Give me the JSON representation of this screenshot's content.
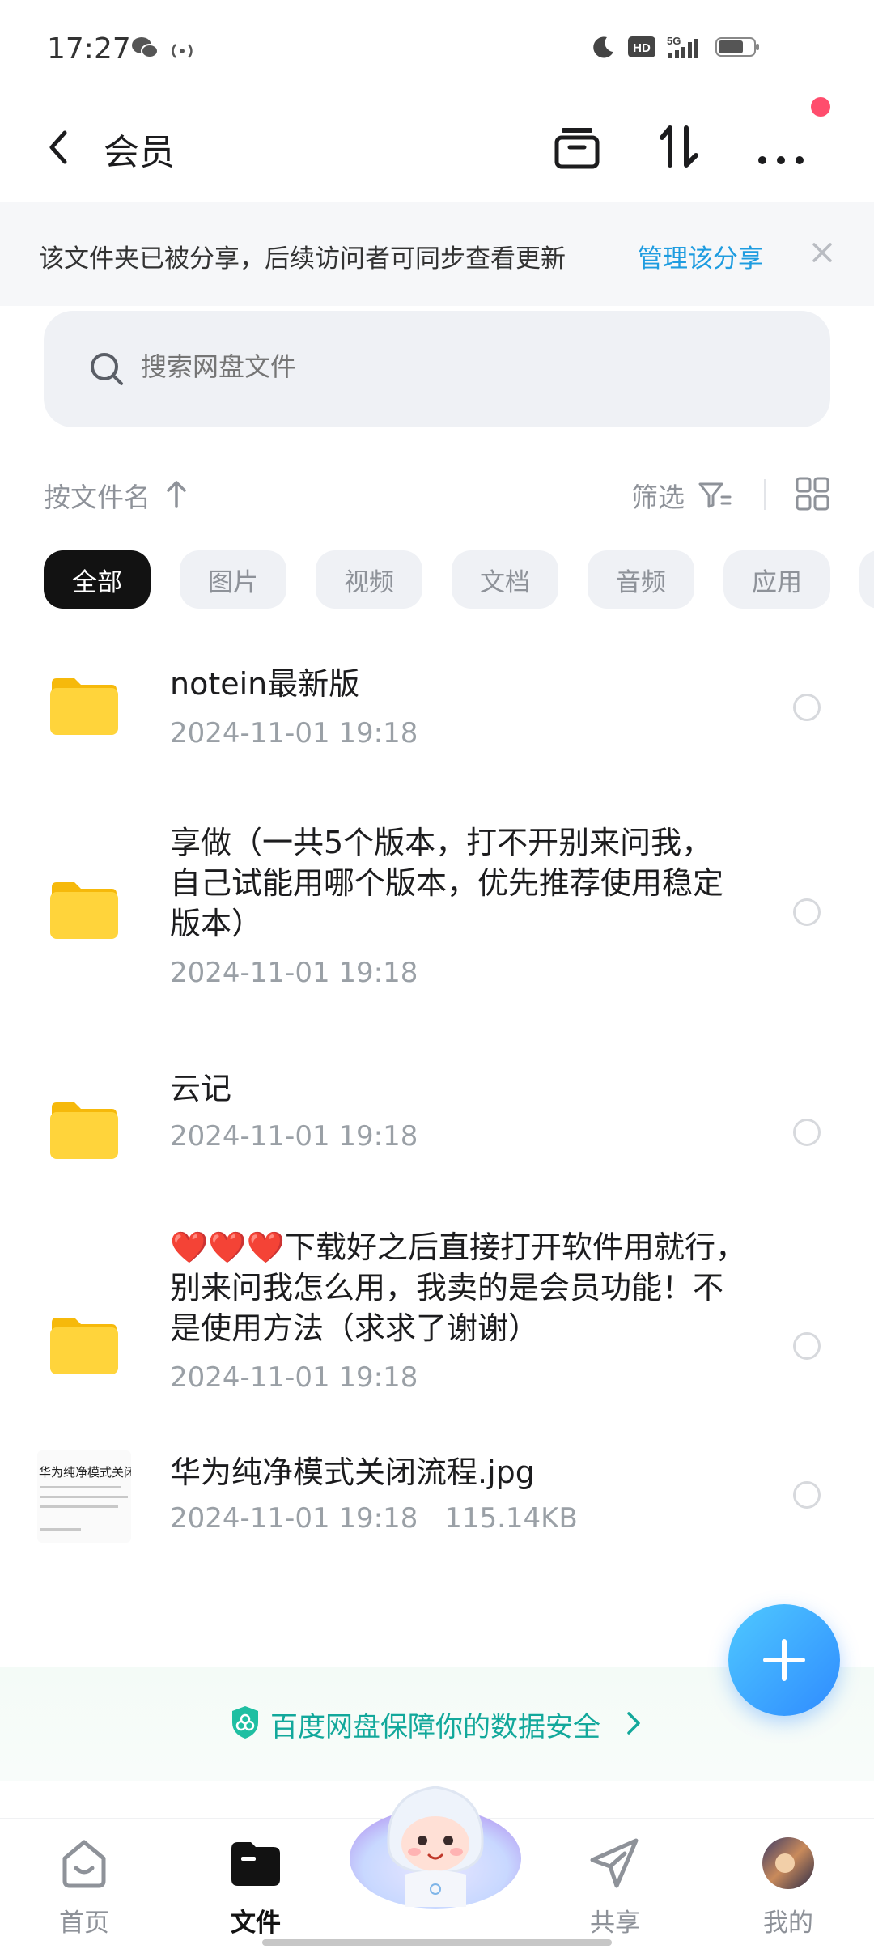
{
  "status_bar": {
    "time": "17:27",
    "hd_label": "HD",
    "network_label": "5G"
  },
  "header": {
    "title": "会员"
  },
  "share_banner": {
    "text": "该文件夹已被分享，后续访问者可同步查看更新",
    "action": "管理该分享"
  },
  "search": {
    "placeholder": "搜索网盘文件"
  },
  "sort": {
    "label": "按文件名",
    "filter_label": "筛选"
  },
  "categories": [
    "全部",
    "图片",
    "视频",
    "文档",
    "音频",
    "应用"
  ],
  "files": [
    {
      "name": "notein最新版",
      "date": "2024-11-01  19:18",
      "type": "folder"
    },
    {
      "name": "享做（一共5个版本，打不开别来问我，自己试能用哪个版本，优先推荐使用稳定版本）",
      "date": "2024-11-01  19:18",
      "type": "folder"
    },
    {
      "name": "云记",
      "date": "2024-11-01  19:18",
      "type": "folder"
    },
    {
      "name": "❤️❤️❤️下载好之后直接打开软件用就行，别来问我怎么用，我卖的是会员功能！不是使用方法（求求了谢谢）",
      "date": "2024-11-01  19:18",
      "type": "folder"
    },
    {
      "name": "华为纯净模式关闭流程.jpg",
      "date": "2024-11-01  19:18",
      "size": "115.14KB",
      "type": "image",
      "thumb_title": "华为纯净模式关闭流程"
    }
  ],
  "security_banner": {
    "text": "百度网盘保障你的数据安全"
  },
  "bottom_nav": [
    {
      "label": "首页",
      "active": false
    },
    {
      "label": "文件",
      "active": true
    },
    {
      "label": "共享",
      "active": false
    },
    {
      "label": "我的",
      "active": false
    }
  ],
  "colors": {
    "accent": "#1e9ce0",
    "security": "#12a89b",
    "notify_dot": "#ff4d6d",
    "folder": "#ffd43b",
    "fab": "#2f8bff"
  }
}
